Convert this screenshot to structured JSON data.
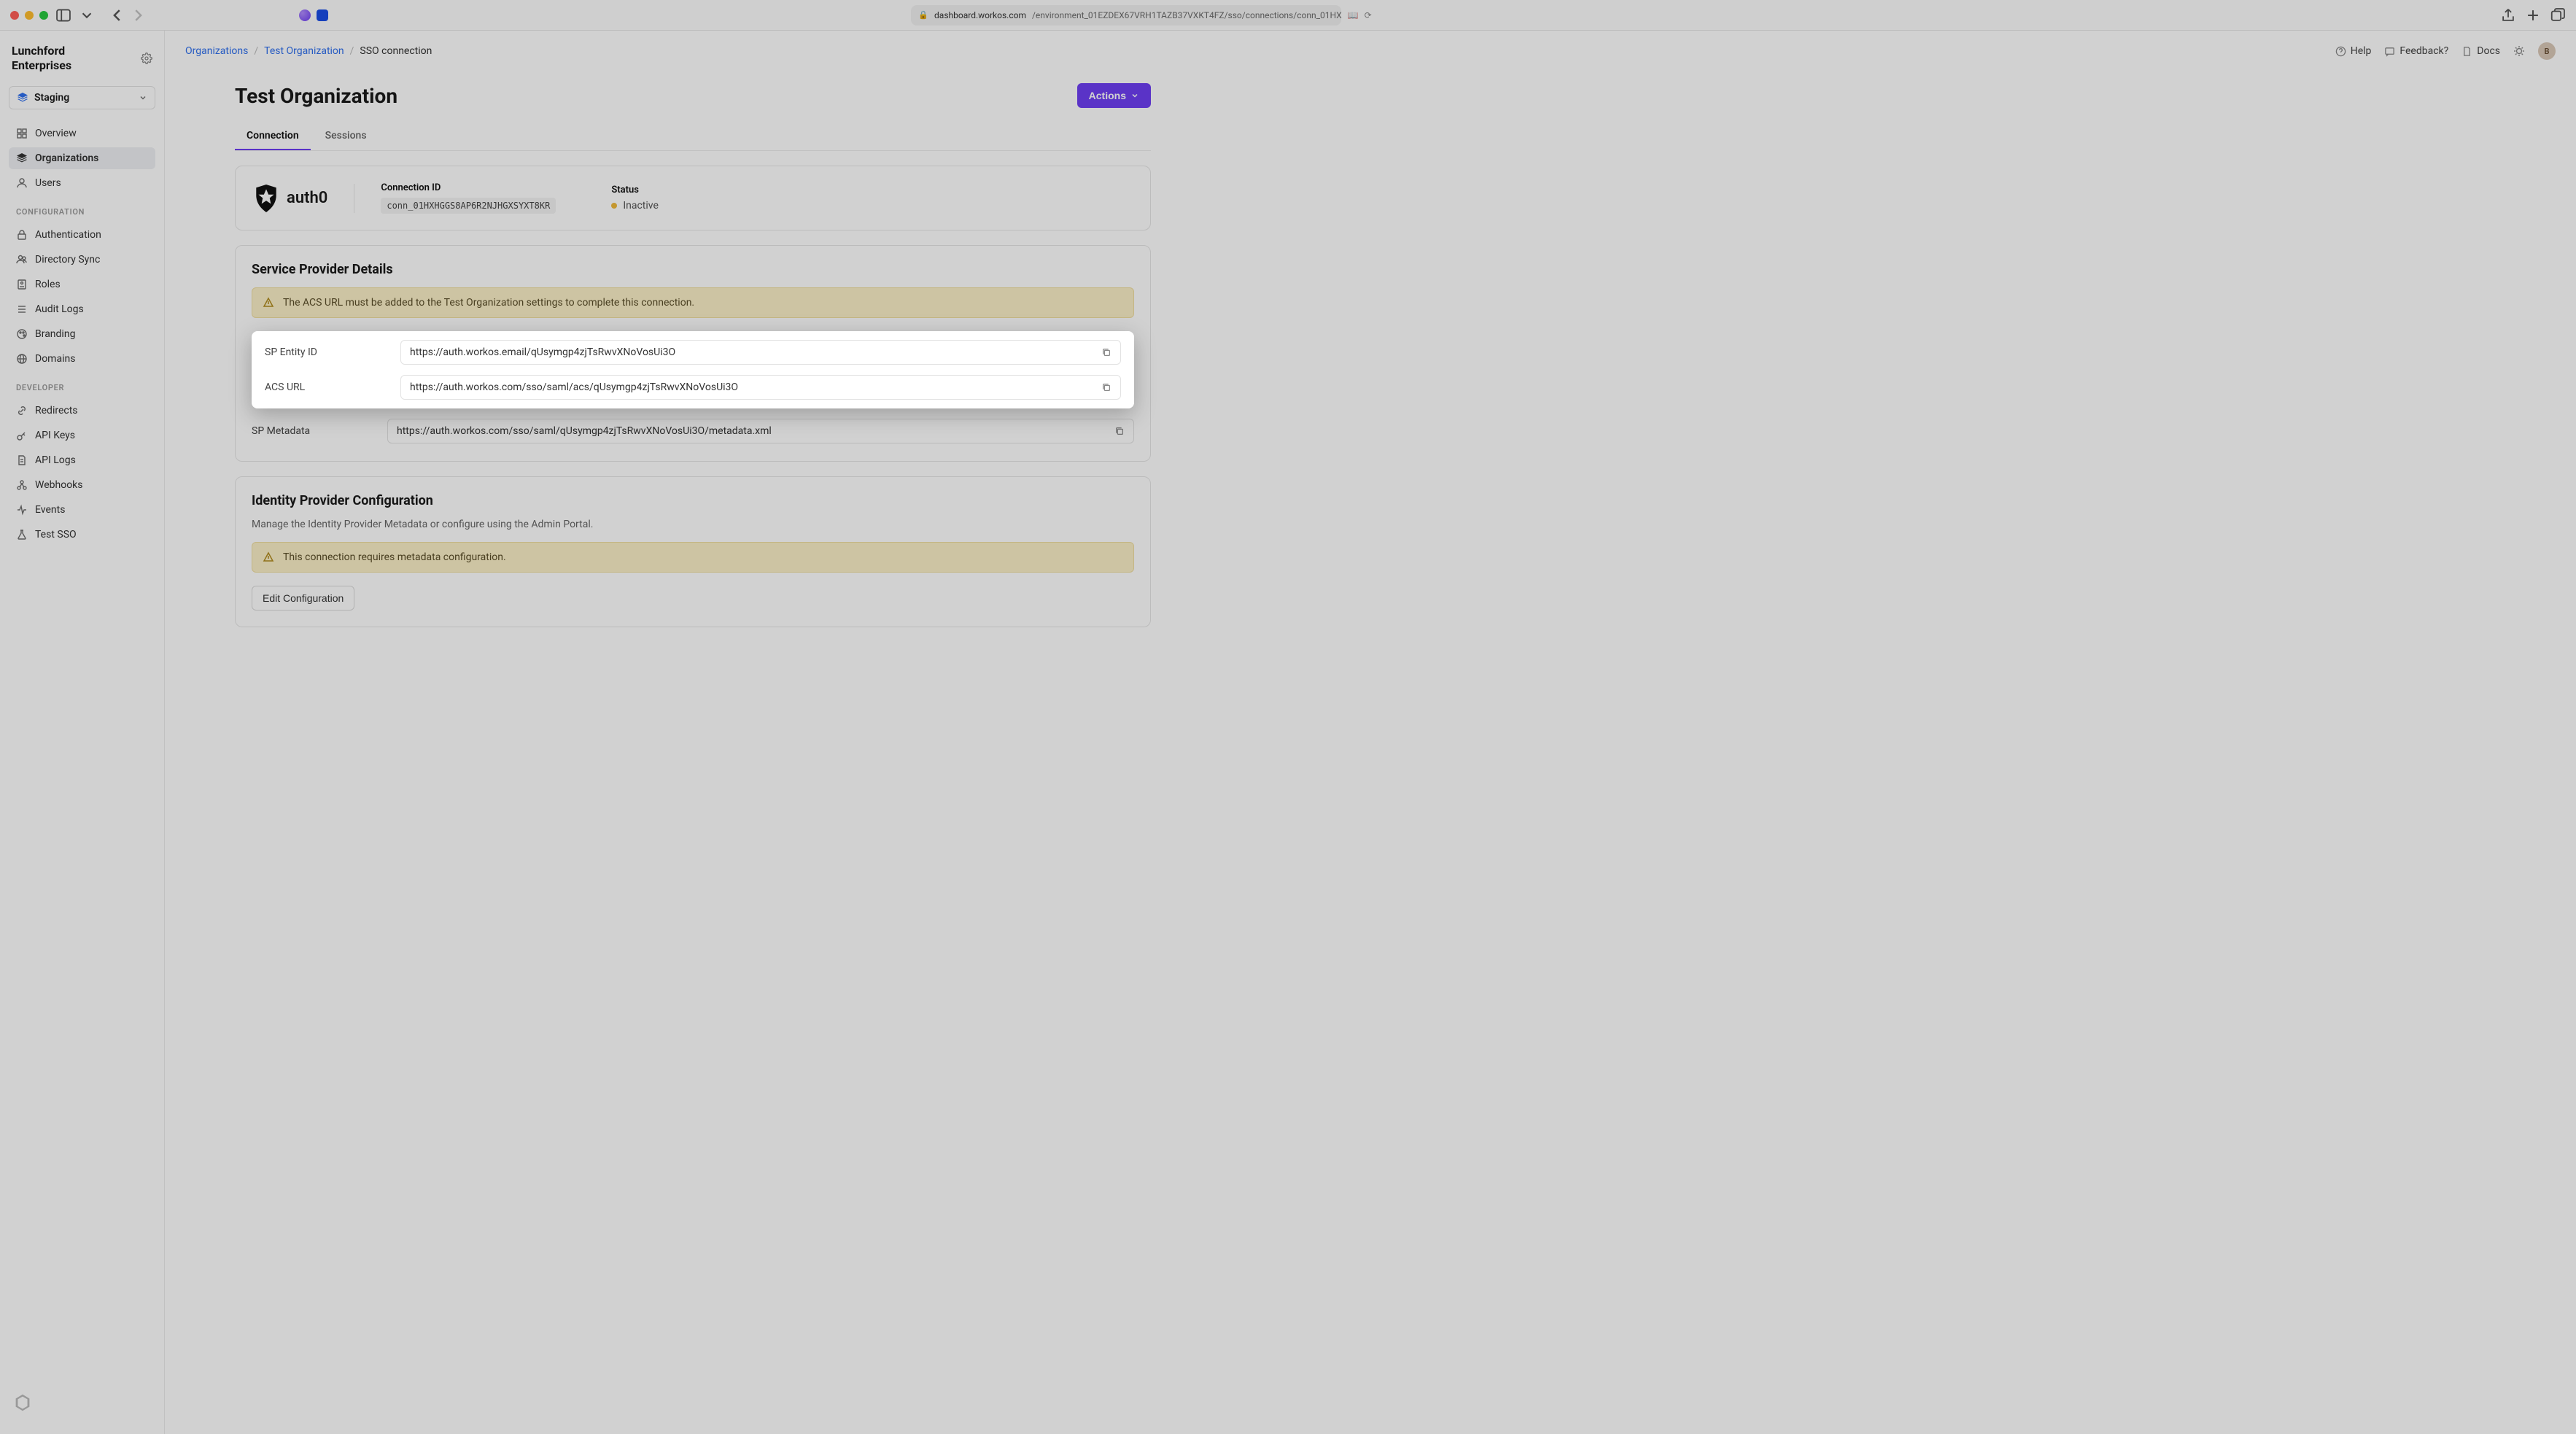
{
  "browser": {
    "url_host": "dashboard.workos.com",
    "url_path": "/environment_01EZDEX67VRH1TAZB37VXKT4FZ/sso/connections/conn_01HX"
  },
  "brand": {
    "name": "Lunchford\nEnterprises"
  },
  "env": {
    "label": "Staging"
  },
  "sidebar": {
    "items": [
      {
        "label": "Overview"
      },
      {
        "label": "Organizations"
      },
      {
        "label": "Users"
      }
    ],
    "sections": {
      "configuration": "CONFIGURATION",
      "developer": "DEVELOPER"
    },
    "config_items": [
      {
        "label": "Authentication"
      },
      {
        "label": "Directory Sync"
      },
      {
        "label": "Roles"
      },
      {
        "label": "Audit Logs"
      },
      {
        "label": "Branding"
      },
      {
        "label": "Domains"
      }
    ],
    "dev_items": [
      {
        "label": "Redirects"
      },
      {
        "label": "API Keys"
      },
      {
        "label": "API Logs"
      },
      {
        "label": "Webhooks"
      },
      {
        "label": "Events"
      },
      {
        "label": "Test SSO"
      }
    ]
  },
  "breadcrumb": {
    "organizations": "Organizations",
    "org": "Test Organization",
    "current": "SSO connection"
  },
  "topbar": {
    "help": "Help",
    "feedback": "Feedback?",
    "docs": "Docs",
    "avatar_initial": "B"
  },
  "page": {
    "title": "Test Organization",
    "actions_btn": "Actions",
    "tabs": {
      "connection": "Connection",
      "sessions": "Sessions"
    }
  },
  "connection": {
    "logo_text": "auth0",
    "id_label": "Connection ID",
    "id_value": "conn_01HXHGGS8AP6R2NJHGXSYXT8KR",
    "status_label": "Status",
    "status_value": "Inactive"
  },
  "sp_details": {
    "title": "Service Provider Details",
    "alert": "The ACS URL must be added to the Test Organization settings to complete this connection.",
    "entity_label": "SP Entity ID",
    "entity_value": "https://auth.workos.email/qUsymgp4zjTsRwvXNoVosUi3O",
    "acs_label": "ACS URL",
    "acs_value": "https://auth.workos.com/sso/saml/acs/qUsymgp4zjTsRwvXNoVosUi3O",
    "metadata_label": "SP Metadata",
    "metadata_value": "https://auth.workos.com/sso/saml/qUsymgp4zjTsRwvXNoVosUi3O/metadata.xml"
  },
  "idp_config": {
    "title": "Identity Provider Configuration",
    "subtitle": "Manage the Identity Provider Metadata or configure using the Admin Portal.",
    "alert": "This connection requires metadata configuration.",
    "edit_btn": "Edit Configuration"
  }
}
